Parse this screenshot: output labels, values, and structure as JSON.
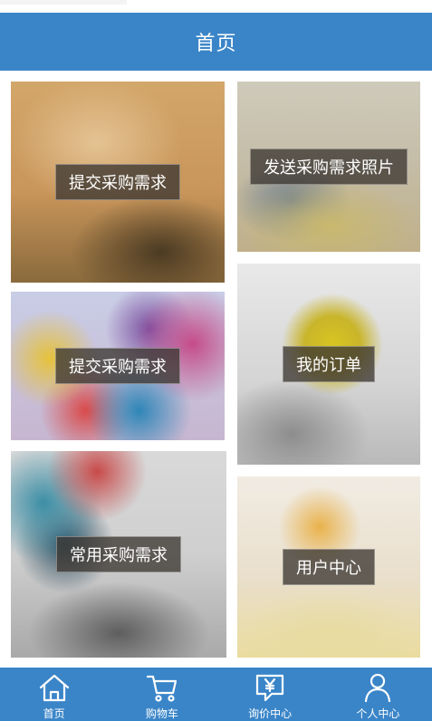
{
  "header": {
    "title": "首页"
  },
  "tiles": [
    {
      "label": "提交采购需求"
    },
    {
      "label": "发送采购需求照片"
    },
    {
      "label": "提交采购需求"
    },
    {
      "label": "我的订单"
    },
    {
      "label": "常用采购需求"
    },
    {
      "label": "用户中心"
    }
  ],
  "tabbar": {
    "items": [
      {
        "label": "首页",
        "icon": "home-icon"
      },
      {
        "label": "购物车",
        "icon": "cart-icon"
      },
      {
        "label": "询价中心",
        "icon": "price-inquiry-icon"
      },
      {
        "label": "个人中心",
        "icon": "person-icon"
      }
    ]
  },
  "colors": {
    "brand": "#3a85c8",
    "label_bg": "#3c3732"
  }
}
